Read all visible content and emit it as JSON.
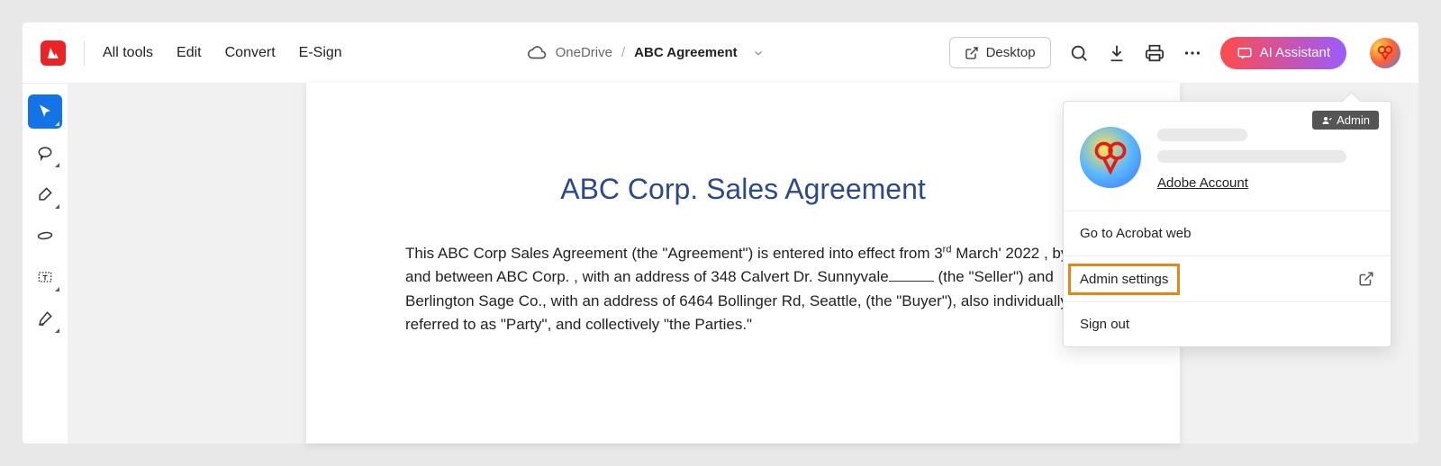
{
  "nav": {
    "items": [
      "All tools",
      "Edit",
      "Convert",
      "E-Sign"
    ]
  },
  "breadcrumb": {
    "source": "OneDrive",
    "separator": "/",
    "file": "ABC Agreement"
  },
  "topbar": {
    "desktop": "Desktop",
    "ai": "AI Assistant"
  },
  "document": {
    "title": "ABC Corp. Sales Agreement",
    "body_1": "This ABC Corp Sales Agreement (the \"Agreement\") is entered into effect from 3",
    "body_sup": "rd",
    "body_2": " March' 2022 , by and between ABC Corp. , with an address of 348 Calvert Dr. Sunnyvale",
    "body_3": " (the \"Seller\") and Berlington Sage Co., with an address of 6464 Bollinger Rd, Seattle, (the \"Buyer\"), also individually referred to as \"Party\", and collectively \"the Parties.\""
  },
  "popover": {
    "badge": "Admin",
    "account_link": "Adobe Account",
    "items": [
      {
        "label": "Go to Acrobat web",
        "external": false
      },
      {
        "label": "Admin settings",
        "external": true,
        "highlighted": true
      },
      {
        "label": "Sign out",
        "external": false
      }
    ]
  },
  "tools": {
    "names": [
      "select",
      "comment",
      "highlight",
      "draw",
      "text-box",
      "sign"
    ]
  }
}
